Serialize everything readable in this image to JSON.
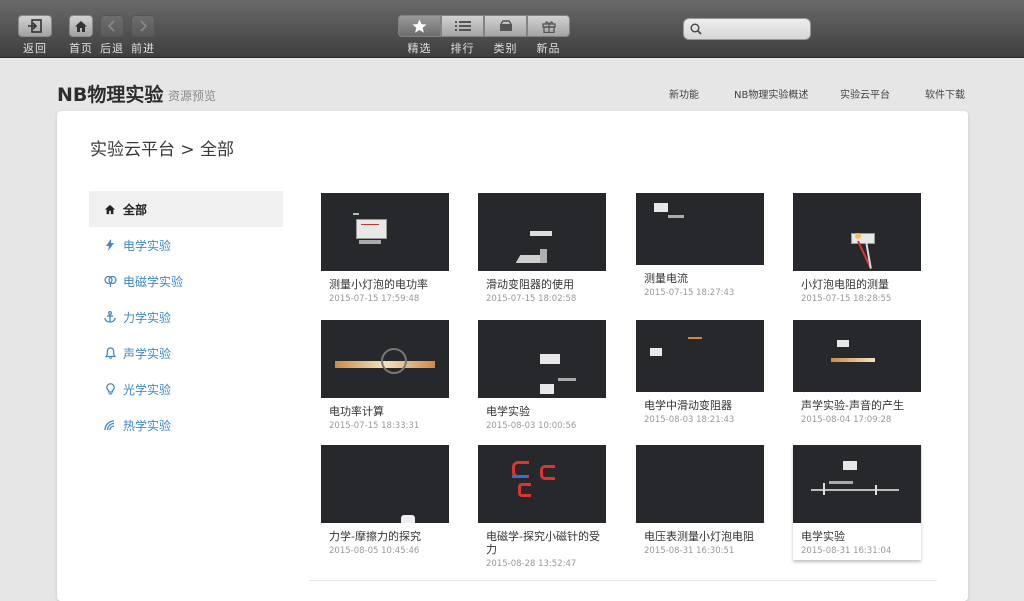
{
  "toolbar": {
    "back_label": "返回",
    "home_label": "首页",
    "prev_label": "后退",
    "next_label": "前进",
    "tabs": [
      {
        "label": "精选",
        "icon": "star-icon"
      },
      {
        "label": "排行",
        "icon": "list-icon"
      },
      {
        "label": "类别",
        "icon": "box-icon"
      },
      {
        "label": "新品",
        "icon": "gift-icon"
      }
    ],
    "search_placeholder": ""
  },
  "header": {
    "brand": "NB物理实验",
    "sub": "资源预览",
    "nav": [
      "新功能",
      "NB物理实验概述",
      "实验云平台",
      "软件下载"
    ]
  },
  "breadcrumb": "实验云平台 > 全部",
  "sidebar": {
    "items": [
      {
        "label": "全部",
        "icon": "home-icon",
        "active": true
      },
      {
        "label": "电学实验",
        "icon": "bolt-icon"
      },
      {
        "label": "电磁学实验",
        "icon": "magnet-icon"
      },
      {
        "label": "力学实验",
        "icon": "anchor-icon"
      },
      {
        "label": "声学实验",
        "icon": "bell-icon"
      },
      {
        "label": "光学实验",
        "icon": "bulb-icon"
      },
      {
        "label": "热学实验",
        "icon": "heat-icon"
      }
    ]
  },
  "experiments": [
    {
      "title": "测量小灯泡的电功率",
      "date": "2015-07-15 17:59:48"
    },
    {
      "title": "滑动变阻器的使用",
      "date": "2015-07-15 18:02:58"
    },
    {
      "title": "测量电流",
      "date": "2015-07-15 18:27:43"
    },
    {
      "title": "小灯泡电阻的测量",
      "date": "2015-07-15 18:28:55"
    },
    {
      "title": "电功率计算",
      "date": "2015-07-15 18:33:31"
    },
    {
      "title": "电学实验",
      "date": "2015-08-03 10:00:56"
    },
    {
      "title": "电学中滑动变阻器",
      "date": "2015-08-03 18:21:43"
    },
    {
      "title": "声学实验-声音的产生",
      "date": "2015-08-04 17:09:28"
    },
    {
      "title": "力学-摩擦力的探究",
      "date": "2015-08-05 10:45:46"
    },
    {
      "title": "电磁学-探究小磁针的受力",
      "date": "2015-08-28 13:52:47"
    },
    {
      "title": "电压表测量小灯泡电阻",
      "date": "2015-08-31 16:30:51"
    },
    {
      "title": "电学实验",
      "date": "2015-08-31 16:31:04"
    }
  ],
  "colors": {
    "accent": "#3f88c5",
    "toolbar_top": "#6a6a6a",
    "toolbar_bottom": "#3e3e3e",
    "thumb_bg": "#26282b"
  }
}
